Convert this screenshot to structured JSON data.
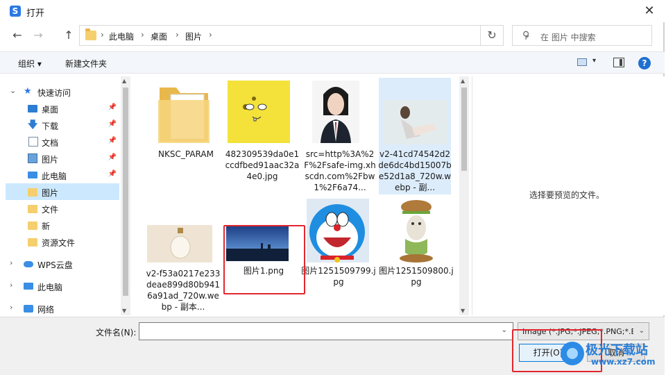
{
  "window": {
    "title": "打开",
    "app_icon_letter": "S",
    "close_glyph": "✕"
  },
  "nav": {
    "back": "←",
    "forward": "→",
    "up": "↑",
    "refresh": "↻",
    "breadcrumbs": [
      "此电脑",
      "桌面",
      "图片"
    ],
    "crumb_sep": "›",
    "dropdown": "⌄",
    "search_placeholder": "在 图片 中搜索"
  },
  "toolbar": {
    "organize": "组织 ▾",
    "new_folder": "新建文件夹",
    "view_dd": "▾",
    "help": "?"
  },
  "sidebar": {
    "items": [
      {
        "label": "快速访问",
        "icon": "star-icon"
      },
      {
        "label": "桌面",
        "icon": "desktop-icon",
        "pin": "📌"
      },
      {
        "label": "下载",
        "icon": "download-icon",
        "pin": "📌"
      },
      {
        "label": "文档",
        "icon": "document-icon",
        "pin": "📌"
      },
      {
        "label": "图片",
        "icon": "pictures-icon",
        "pin": "📌"
      },
      {
        "label": "此电脑",
        "icon": "computer-icon",
        "pin": "📌"
      },
      {
        "label": "图片",
        "icon": "folder-icon"
      },
      {
        "label": "文件",
        "icon": "folder-icon"
      },
      {
        "label": "新",
        "icon": "folder-icon"
      },
      {
        "label": "资源文件",
        "icon": "folder-icon"
      },
      {
        "label": "WPS云盘",
        "icon": "cloud-icon"
      },
      {
        "label": "此电脑",
        "icon": "computer-icon"
      },
      {
        "label": "网络",
        "icon": "network-icon"
      }
    ],
    "chevron_down": "⌄",
    "chevron_right": "›"
  },
  "files": [
    {
      "name": "NKSC_PARAM"
    },
    {
      "name": "482309539da0e1ccdfbed91aac32a4e0.jpg"
    },
    {
      "name": "src=http%3A%2F%2Fsafe-img.xhscdn.com%2Fbw1%2F6a74..."
    },
    {
      "name": "v2-41cd74542d2de6dc4bd15007be52d1a8_720w.webp - 副..."
    },
    {
      "name": "v2-f53a0217e233deae899d80b9416a91ad_720w.webp - 副本..."
    },
    {
      "name": "图片1.png"
    },
    {
      "name": "图片1251509799.jpg"
    },
    {
      "name": "图片1251509800.jpg"
    }
  ],
  "preview_text": "选择要预览的文件。",
  "footer": {
    "filename_label": "文件名(N):",
    "filename_value": "",
    "filetype": "Image (*.JPG;*.JPEG;*.PNG;*.BMP)",
    "dd": "⌄",
    "open_label": "打开(O)",
    "cancel_label": "取消"
  },
  "watermark": {
    "text": "极光下载站",
    "url": "www.xz7.com"
  },
  "colors": {
    "accent": "#0078d7",
    "selection": "#cce8ff",
    "highlight": "#e3262f",
    "folder": "#f5cf6e"
  }
}
